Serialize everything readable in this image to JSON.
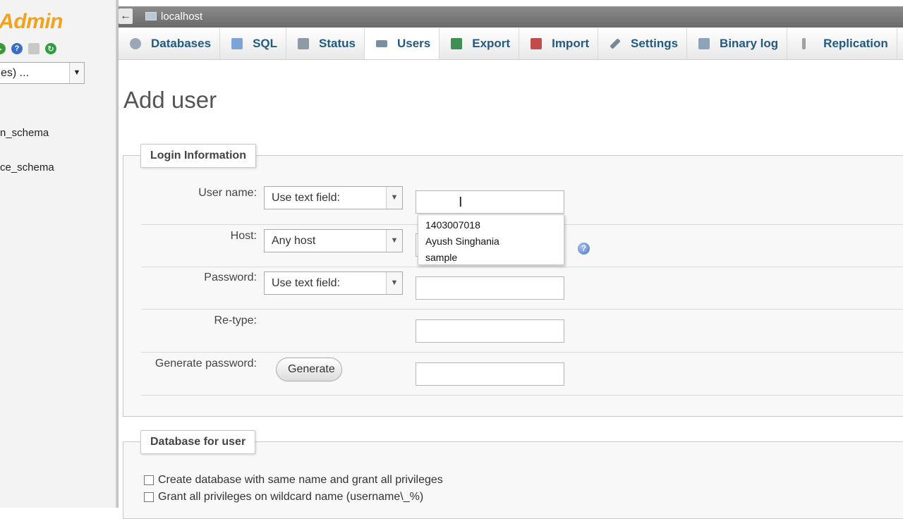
{
  "nav": {
    "logo_text": "yAdmin",
    "icons": [
      {
        "name": "home-icon",
        "color": "#3a9a3a"
      },
      {
        "name": "help-icon",
        "color": "#3c6fc4"
      },
      {
        "name": "docs-icon",
        "color": "#b0b0b0"
      },
      {
        "name": "reload-icon",
        "color": "#2e9e3e"
      }
    ],
    "db_select_value": "es) ...",
    "databases": [
      "n_schema",
      "ce_schema"
    ]
  },
  "topbar": {
    "server_label": "localhost"
  },
  "tabs": [
    {
      "label": "Databases",
      "icon": "database-icon",
      "color": "#9aa7b6",
      "active": false
    },
    {
      "label": "SQL",
      "icon": "sql-icon",
      "color": "#7ca4d6",
      "active": false
    },
    {
      "label": "Status",
      "icon": "status-icon",
      "color": "#8e9aa8",
      "active": false
    },
    {
      "label": "Users",
      "icon": "users-icon",
      "color": "#7b8da3",
      "active": true
    },
    {
      "label": "Export",
      "icon": "export-icon",
      "color": "#3f8f55",
      "active": false
    },
    {
      "label": "Import",
      "icon": "import-icon",
      "color": "#c24b4b",
      "active": false
    },
    {
      "label": "Settings",
      "icon": "settings-icon",
      "color": "#7a8796",
      "active": false
    },
    {
      "label": "Binary log",
      "icon": "binary-log-icon",
      "color": "#8fa3b8",
      "active": false
    },
    {
      "label": "Replication",
      "icon": "replication-icon",
      "color": "#a0a0a0",
      "active": false
    }
  ],
  "page": {
    "title": "Add user"
  },
  "login": {
    "legend": "Login Information",
    "username_label": "User name:",
    "username_select": "Use text field:",
    "host_label": "Host:",
    "host_select": "Any host",
    "password_label": "Password:",
    "password_select": "Use text field:",
    "retype_label": "Re-type:",
    "generate_label": "Generate password:",
    "generate_button": "Generate",
    "autocomplete": [
      "1403007018",
      "Ayush Singhania",
      "sample"
    ]
  },
  "database": {
    "legend": "Database for user",
    "options": [
      "Create database with same name and grant all privileges",
      "Grant all privileges on wildcard name (username\\_%)"
    ]
  }
}
